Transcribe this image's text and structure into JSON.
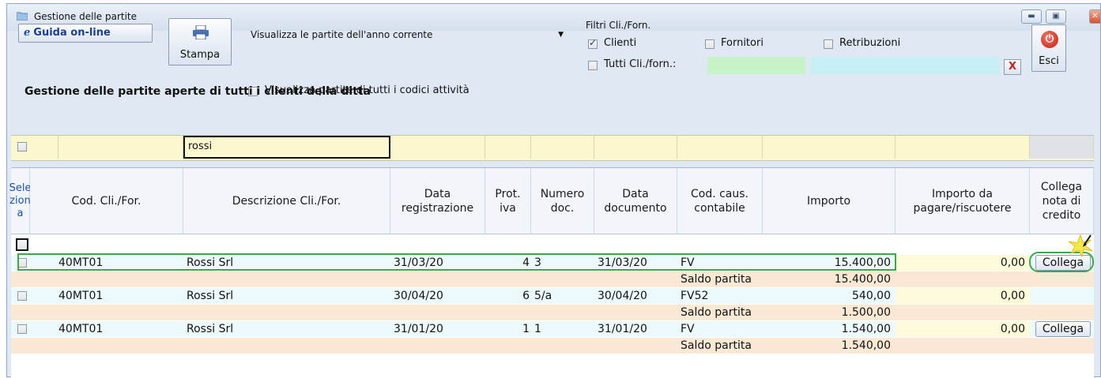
{
  "window": {
    "title": "Gestione delle partite",
    "controls": [
      "minimize",
      "maximize",
      "close"
    ]
  },
  "toolbar": {
    "help_label": "Guida on-line",
    "help_icon": "ie-icon",
    "print_label": "Stampa",
    "view_select": "Visualizza le partite dell'anno corrente",
    "all_codes_label": "Visualizza partite di tutti i codici attività",
    "all_codes_checked": false,
    "filters_title": "Filtri Cli./Forn.",
    "clienti_label": "Clienti",
    "clienti_checked": true,
    "fornitori_label": "Fornitori",
    "fornitori_checked": false,
    "retribuzioni_label": "Retribuzioni",
    "retribuzioni_checked": false,
    "tutti_label": "Tutti Cli./forn.:",
    "tutti_checked": false,
    "clear_label": "X",
    "exit_label": "Esci"
  },
  "section_title": "Gestione delle partite aperte di tutti i clienti della ditta",
  "search": {
    "value": "rossi"
  },
  "colors": {
    "accent_green": "#3aa84a",
    "detail_row": "#edfafd",
    "balance_row": "#fbe9d6",
    "filter_row": "#fbf7cf"
  },
  "table": {
    "headers": {
      "sel": "Sele zion a",
      "cod": "Cod. Cli./For.",
      "desc": "Descrizione Cli./For.",
      "datareg": "Data registrazione",
      "prot": "Prot. iva",
      "numdoc": "Numero doc.",
      "datadoc": "Data documento",
      "caus": "Cod. caus. contabile",
      "importo": "Importo",
      "dapagare": "Importo da pagare/riscuotere",
      "collega": "Collega nota di credito"
    },
    "rows": [
      {
        "cod": "40MT01",
        "desc": "Rossi Srl",
        "datareg": "31/03/20",
        "prot": "4",
        "numdoc": "3",
        "datadoc": "31/03/20",
        "caus": "FV",
        "importo": "15.400,00",
        "dapagare": "0,00",
        "button": "Collega",
        "saldo_label": "Saldo partita",
        "saldo": "15.400,00"
      },
      {
        "cod": "40MT01",
        "desc": "Rossi Srl",
        "datareg": "30/04/20",
        "prot": "6",
        "numdoc": "5/a",
        "datadoc": "30/04/20",
        "caus": "FV52",
        "importo": "540,00",
        "dapagare": "0,00",
        "button": "",
        "saldo_label": "Saldo partita",
        "saldo": "1.500,00"
      },
      {
        "cod": "40MT01",
        "desc": "Rossi Srl",
        "datareg": "31/01/20",
        "prot": "1",
        "numdoc": "1",
        "datadoc": "31/01/20",
        "caus": "FV",
        "importo": "1.540,00",
        "dapagare": "0,00",
        "button": "Collega",
        "saldo_label": "Saldo partita",
        "saldo": "1.540,00"
      }
    ]
  }
}
